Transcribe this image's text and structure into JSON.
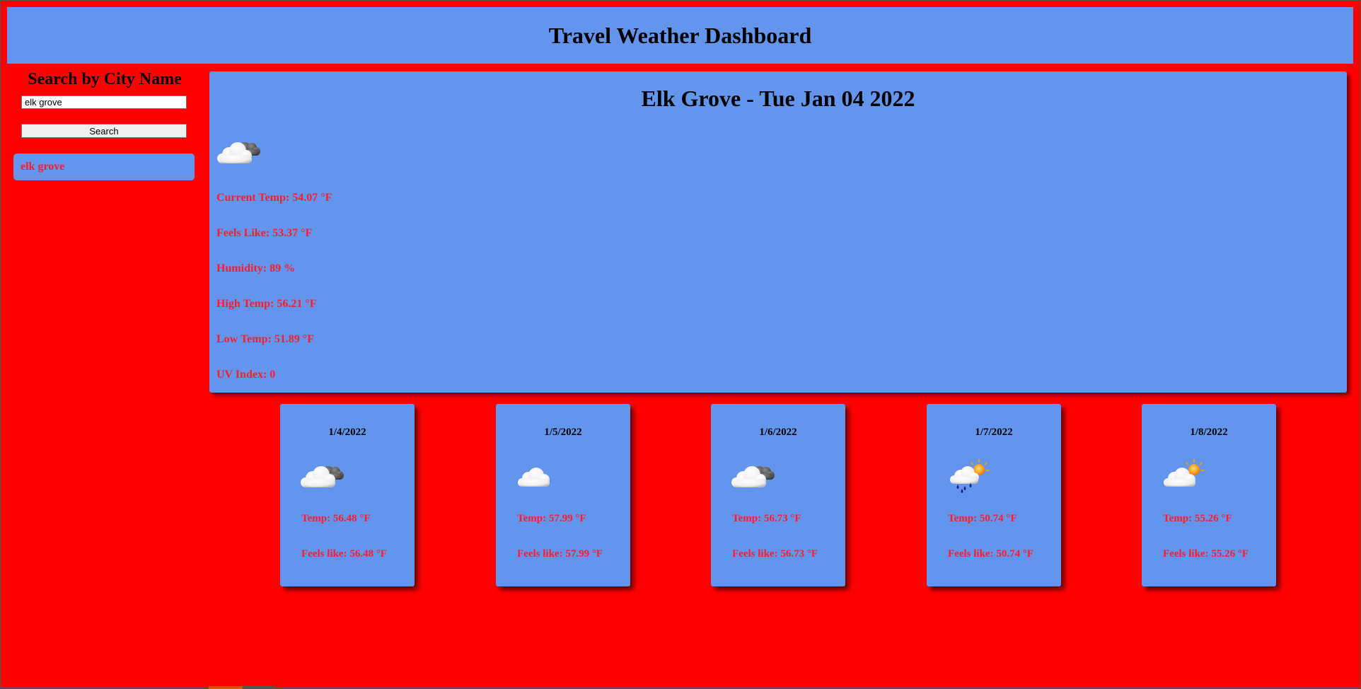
{
  "header": {
    "title": "Travel Weather Dashboard"
  },
  "sidebar": {
    "heading": "Search by City Name",
    "search_value": "elk grove",
    "search_button": "Search",
    "history": [
      {
        "label": "elk grove"
      }
    ]
  },
  "current": {
    "title": "Elk Grove - Tue Jan 04 2022",
    "icon": "cloudy-icon",
    "current_temp": "Current Temp: 54.07 °F",
    "feels_like": "Feels Like: 53.37 °F",
    "humidity": "Humidity: 89 %",
    "high_temp": "High Temp: 56.21 °F",
    "low_temp": "Low Temp: 51.89 °F",
    "uv_index": "UV Index: 0"
  },
  "forecast": [
    {
      "date": "1/4/2022",
      "icon": "cloudy-icon",
      "temp": "Temp: 56.48 °F",
      "feels": "Feels like: 56.48 °F"
    },
    {
      "date": "1/5/2022",
      "icon": "cloud-icon",
      "temp": "Temp: 57.99 °F",
      "feels": "Feels like: 57.99 °F"
    },
    {
      "date": "1/6/2022",
      "icon": "cloudy-icon",
      "temp": "Temp: 56.73 °F",
      "feels": "Feels like: 56.73 °F"
    },
    {
      "date": "1/7/2022",
      "icon": "rain-sun-icon",
      "temp": "Temp: 50.74 °F",
      "feels": "Feels like: 50.74 °F"
    },
    {
      "date": "1/8/2022",
      "icon": "partly-sunny-icon",
      "temp": "Temp: 55.26 °F",
      "feels": "Feels like: 55.26 °F"
    }
  ],
  "colors": {
    "page_background": "#ff0000",
    "panel": "#6495ed",
    "stat_text": "#ff1a2e"
  }
}
